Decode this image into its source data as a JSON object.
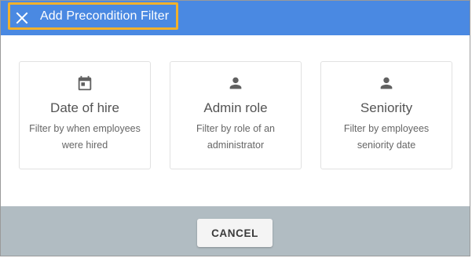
{
  "dialog": {
    "title": "Add Precondition Filter",
    "close_icon": "close-icon",
    "header_color": "#4a89e2",
    "highlight_color": "#f2b12b"
  },
  "cards": [
    {
      "icon": "calendar-icon",
      "title": "Date of hire",
      "description": "Filter by when employees were hired"
    },
    {
      "icon": "person-icon",
      "title": "Admin role",
      "description": "Filter by role of an administrator"
    },
    {
      "icon": "person-icon",
      "title": "Seniority",
      "description": "Filter by employees seniority date"
    }
  ],
  "footer": {
    "cancel_label": "CANCEL",
    "background_color": "#b1bcc2"
  }
}
